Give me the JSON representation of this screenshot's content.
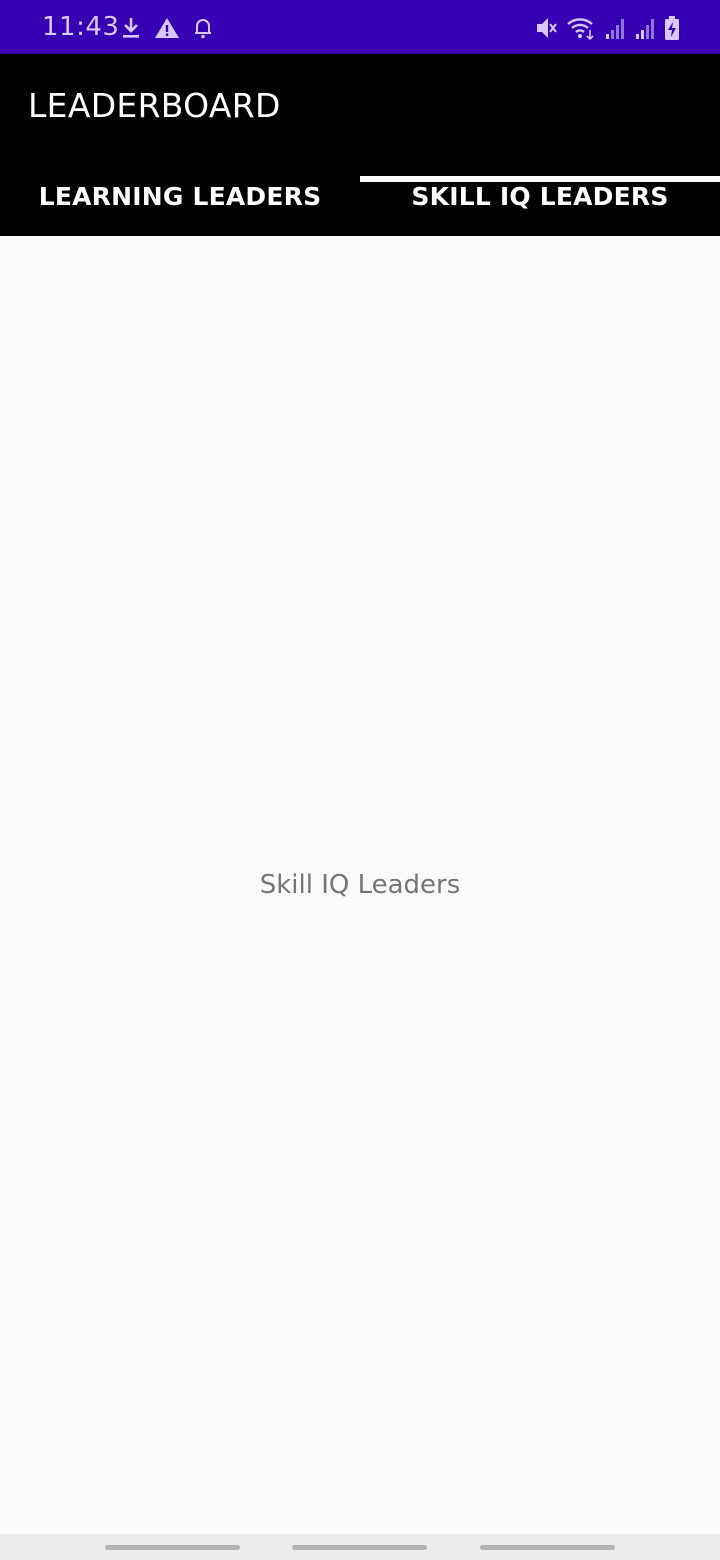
{
  "status_bar": {
    "time": "11:43",
    "background_color": "#3700b3",
    "left_icons": [
      "download-icon",
      "warning-icon",
      "bell-icon"
    ],
    "right_icons": [
      "mute-icon",
      "wifi-icon",
      "signal-icon",
      "signal-icon",
      "battery-charging-icon"
    ]
  },
  "app_bar": {
    "title": "LEADERBOARD",
    "background_color": "#000000"
  },
  "tabs": [
    {
      "label": "LEARNING LEADERS",
      "selected": false
    },
    {
      "label": "SKILL IQ LEADERS",
      "selected": true
    }
  ],
  "content": {
    "section_label": "Skill IQ Leaders"
  },
  "nav_bar": {
    "buttons": [
      "recent-apps-button",
      "home-button",
      "back-button"
    ]
  }
}
